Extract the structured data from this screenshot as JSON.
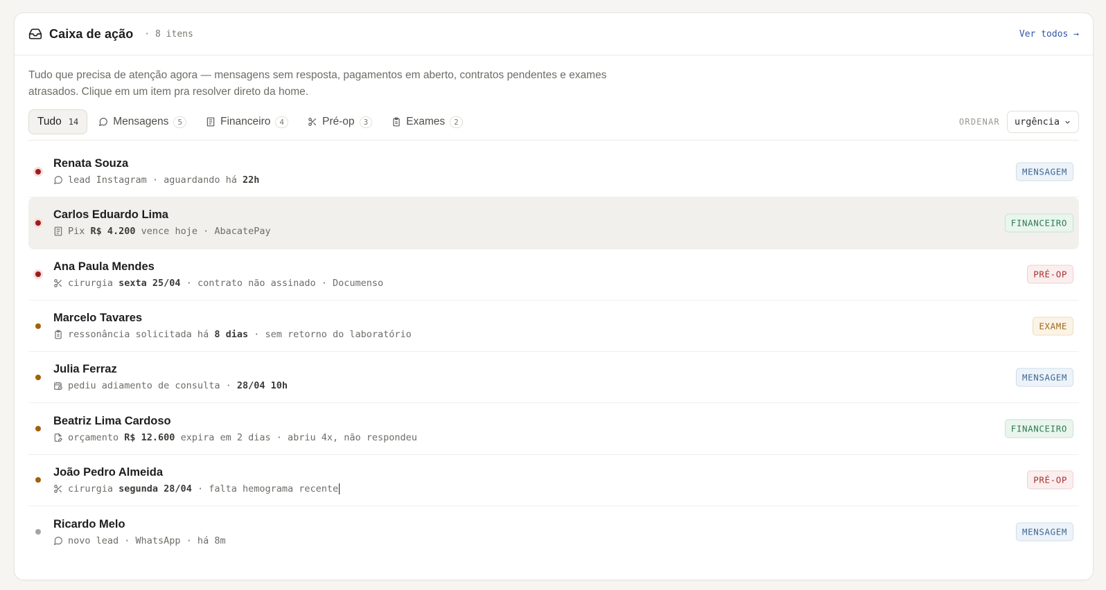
{
  "header": {
    "title": "Caixa de ação",
    "count": "· 8 itens",
    "see_all": "Ver todos →"
  },
  "description": "Tudo que precisa de atenção agora — mensagens sem resposta, pagamentos em aberto, contratos pendentes e exames atrasados. Clique em um item pra resolver direto da home.",
  "filters": {
    "tabs": [
      {
        "label": "Tudo",
        "count": "14",
        "icon": "none"
      },
      {
        "label": "Mensagens",
        "count": "5",
        "icon": "chat-icon"
      },
      {
        "label": "Financeiro",
        "count": "4",
        "icon": "receipt-icon"
      },
      {
        "label": "Pré-op",
        "count": "3",
        "icon": "scissors-icon"
      },
      {
        "label": "Exames",
        "count": "2",
        "icon": "clipboard-icon"
      }
    ],
    "sort_label": "ORDENAR",
    "sort_value": "urgência"
  },
  "items": [
    {
      "name": "Renata Souza",
      "icon": "chat-icon",
      "meta": [
        [
          "lead Instagram · aguardando há ",
          false
        ],
        [
          "22h",
          true
        ]
      ],
      "tag": "MENSAGEM",
      "priority": "high"
    },
    {
      "name": "Carlos Eduardo Lima",
      "icon": "receipt-icon",
      "meta": [
        [
          "Pix ",
          false
        ],
        [
          "R$ 4.200",
          true
        ],
        [
          " vence hoje · AbacatePay",
          false
        ]
      ],
      "tag": "FINANCEIRO",
      "priority": "high"
    },
    {
      "name": "Ana Paula Mendes",
      "icon": "scissors-icon",
      "meta": [
        [
          "cirurgia ",
          false
        ],
        [
          "sexta 25/04",
          true
        ],
        [
          " · contrato não assinado · Documenso",
          false
        ]
      ],
      "tag": "PRÉ-OP",
      "priority": "high"
    },
    {
      "name": "Marcelo Tavares",
      "icon": "clipboard-icon",
      "meta": [
        [
          "ressonância solicitada há ",
          false
        ],
        [
          "8 dias",
          true
        ],
        [
          " · sem retorno do laboratório",
          false
        ]
      ],
      "tag": "EXAME",
      "priority": "medium"
    },
    {
      "name": "Julia Ferraz",
      "icon": "calendar-clock-icon",
      "meta": [
        [
          "pediu adiamento de consulta · ",
          false
        ],
        [
          "28/04 10h",
          true
        ]
      ],
      "tag": "MENSAGEM",
      "priority": "medium"
    },
    {
      "name": "Beatriz Lima Cardoso",
      "icon": "document-edit-icon",
      "meta": [
        [
          "orçamento ",
          false
        ],
        [
          "R$ 12.600",
          true
        ],
        [
          " expira em 2 dias · abriu 4x, não respondeu",
          false
        ]
      ],
      "tag": "FINANCEIRO",
      "priority": "medium"
    },
    {
      "name": "João Pedro Almeida",
      "icon": "scissors-icon",
      "meta": [
        [
          "cirurgia ",
          false
        ],
        [
          "segunda 28/04",
          true
        ],
        [
          " · falta hemograma recente",
          false
        ]
      ],
      "tag": "PRÉ-OP",
      "priority": "medium"
    },
    {
      "name": "Ricardo Melo",
      "icon": "chat-icon",
      "meta": [
        [
          "novo lead · WhatsApp · há 8m",
          false
        ]
      ],
      "tag": "MENSAGEM",
      "priority": "low"
    }
  ],
  "colors": {
    "high": "#9e1b1b",
    "medium": "#a0610a",
    "low": "#a6a49e",
    "link": "#2f57a6"
  }
}
